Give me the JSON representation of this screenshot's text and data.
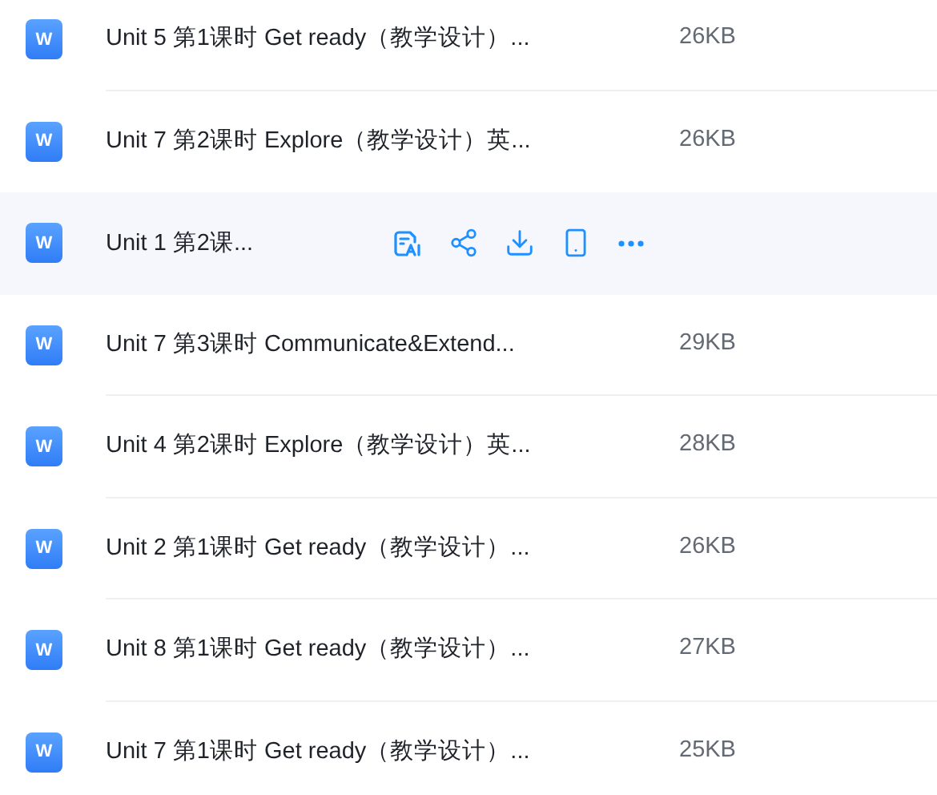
{
  "files": [
    {
      "icon_label": "W",
      "name": "Unit 5 第1课时 Get ready（教学设计）...",
      "size": "26KB"
    },
    {
      "icon_label": "W",
      "name": "Unit 7 第2课时 Explore（教学设计）英...",
      "size": "26KB"
    },
    {
      "icon_label": "W",
      "name": "Unit 1 第2课...",
      "actions": [
        {
          "kind": "ai-read"
        },
        {
          "kind": "share"
        },
        {
          "kind": "download"
        },
        {
          "kind": "phone"
        },
        {
          "kind": "more"
        }
      ]
    },
    {
      "icon_label": "W",
      "name": "Unit 7 第3课时 Communicate&Extend...",
      "size": "29KB"
    },
    {
      "icon_label": "W",
      "name": "Unit 4 第2课时 Explore（教学设计）英...",
      "size": "28KB"
    },
    {
      "icon_label": "W",
      "name": "Unit 2 第1课时 Get ready（教学设计）...",
      "size": "26KB"
    },
    {
      "icon_label": "W",
      "name": "Unit 8 第1课时 Get ready（教学设计）...",
      "size": "27KB"
    },
    {
      "icon_label": "W",
      "name": "Unit 7 第1课时 Get ready（教学设计）...",
      "size": "25KB"
    }
  ]
}
